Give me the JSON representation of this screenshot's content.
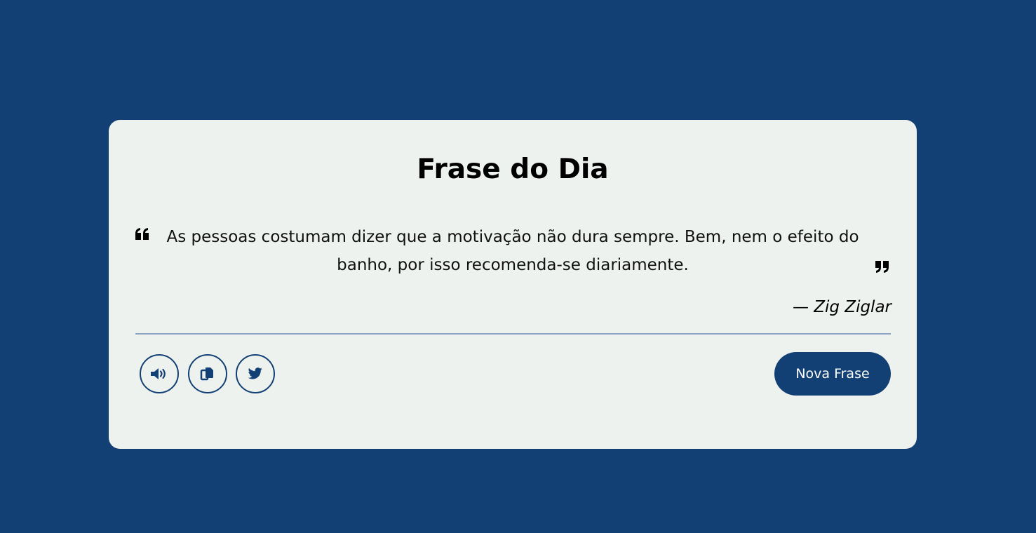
{
  "card": {
    "title": "Frase do Dia",
    "quote": {
      "text": "As pessoas costumam dizer que a motivação não dura sempre. Bem, nem o efeito do banho, por isso recomenda-se diariamente."
    },
    "author": {
      "dash": "—",
      "name": "Zig Ziglar"
    },
    "actions": {
      "speak_icon": "volume-icon",
      "copy_icon": "copy-icon",
      "twitter_icon": "twitter-icon",
      "new_quote_label": "Nova Frase"
    }
  },
  "colors": {
    "background": "#134074",
    "card": "#eef2ee",
    "accent": "#134074",
    "divider": "#8aa4c3"
  }
}
